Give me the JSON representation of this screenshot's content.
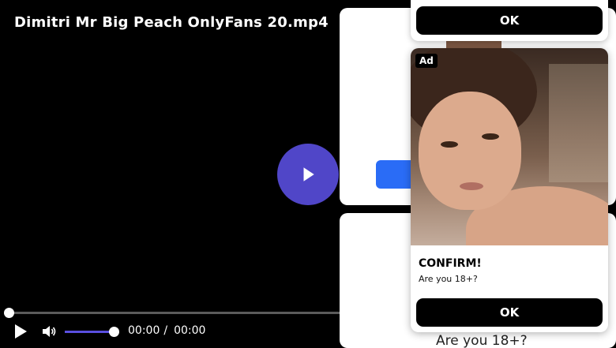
{
  "video": {
    "title": "Dimitri Mr Big Peach OnlyFans 20.mp4",
    "current_time": "00:00",
    "separator": "/",
    "duration": "00:00",
    "progress": 0,
    "volume": 1.0
  },
  "background_card": {
    "question": "Are you 18+?"
  },
  "popup_top": {
    "ok_label": "OK"
  },
  "ad": {
    "badge": "Ad",
    "heading": "CONFIRM!",
    "subtext": "Are you 18+?",
    "ok_label": "OK"
  },
  "colors": {
    "play_button": "#5046c8",
    "volume_fill": "#5a4fe0",
    "blue_button": "#2a6cf6",
    "ok_button": "#000000"
  },
  "icons": [
    "play-icon",
    "volume-icon"
  ]
}
